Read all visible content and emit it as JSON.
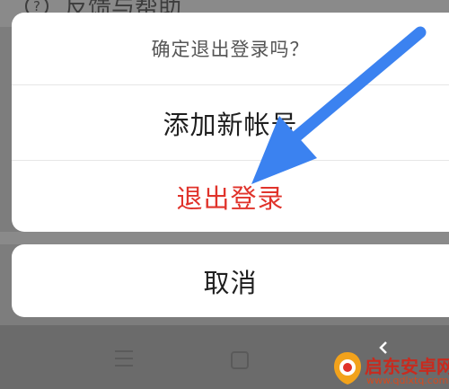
{
  "background": {
    "row_icon": "?",
    "row_label": "反馈与帮助"
  },
  "dialog": {
    "title": "确定退出登录吗？",
    "add_account": "添加新帐号",
    "logout": "退出登录",
    "cancel": "取消"
  },
  "watermark": {
    "title": "启东安卓网",
    "url": "www.qdlxtq.com"
  },
  "colors": {
    "logout_red": "#e0332b",
    "arrow_blue": "#3b82f0"
  },
  "icons": {
    "nav_menu": "menu-icon",
    "nav_home": "home-icon",
    "nav_back": "back-icon",
    "annotation": "arrow-pointer-icon"
  }
}
